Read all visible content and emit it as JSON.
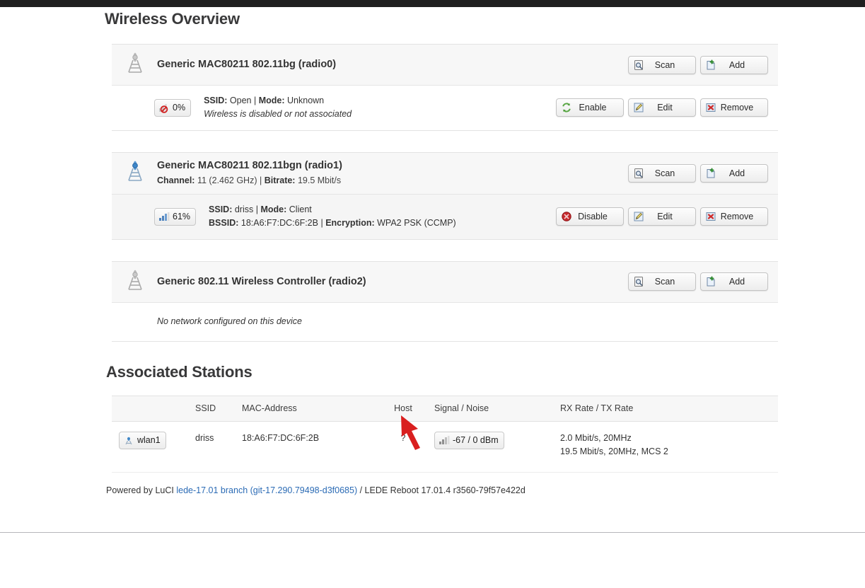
{
  "page": {
    "overview_title": "Wireless Overview",
    "stations_title": "Associated Stations"
  },
  "buttons": {
    "scan": "Scan",
    "add": "Add",
    "enable": "Enable",
    "disable": "Disable",
    "edit": "Edit",
    "remove": "Remove"
  },
  "radios": [
    {
      "icon": "antenna-disabled-icon",
      "title": "Generic MAC80211 802.11bg (radio0)",
      "subtitle": "",
      "signal": {
        "icon": "signal-none-icon",
        "text": "0%"
      },
      "line1_label_a": "SSID:",
      "line1_value_a": "Open",
      "line1_sep": "|",
      "line1_label_b": "Mode:",
      "line1_value_b": "Unknown",
      "line2_note": "Wireless is disabled or not associated",
      "toggle": "Enable"
    },
    {
      "icon": "antenna-active-icon",
      "title": "Generic MAC80211 802.11bgn (radio1)",
      "sub_label_a": "Channel:",
      "sub_value_a": "11 (2.462 GHz)",
      "sub_sep": "|",
      "sub_label_b": "Bitrate:",
      "sub_value_b": "19.5 Mbit/s",
      "signal": {
        "icon": "signal-good-icon",
        "text": "61%"
      },
      "line1_label_a": "SSID:",
      "line1_value_a": "driss",
      "line1_sep": "|",
      "line1_label_b": "Mode:",
      "line1_value_b": "Client",
      "line2_label_a": "BSSID:",
      "line2_value_a": "18:A6:F7:DC:6F:2B",
      "line2_sep": "|",
      "line2_label_b": "Encryption:",
      "line2_value_b": "WPA2 PSK (CCMP)",
      "toggle": "Disable"
    },
    {
      "icon": "antenna-disabled-icon",
      "title": "Generic 802.11 Wireless Controller (radio2)",
      "empty_note": "No network configured on this device"
    }
  ],
  "stations": {
    "headers": [
      "",
      "SSID",
      "MAC-Address",
      "Host",
      "Signal / Noise",
      "RX Rate / TX Rate"
    ],
    "rows": [
      {
        "iface": "wlan1",
        "iface_icon": "wifi-iface-icon",
        "ssid": "driss",
        "mac": "18:A6:F7:DC:6F:2B",
        "host": "?",
        "signal_icon": "signal-bars-icon",
        "signal": "-67 / 0 dBm",
        "rx_rate": "2.0 Mbit/s, 20MHz",
        "tx_rate": "19.5 Mbit/s, 20MHz, MCS 2"
      }
    ]
  },
  "footer": {
    "prefix": "Powered by LuCI",
    "link": "lede-17.01 branch (git-17.290.79498-d3f0685)",
    "suffix": "/ LEDE Reboot 17.01.4 r3560-79f57e422d"
  },
  "colors": {
    "link": "#2b6bb5",
    "annotation_arrow": "#d91f1f",
    "panel_header_bg": "#f7f7f7",
    "row_shaded_bg": "#f5f5f5"
  },
  "annotation": {
    "arrow": "red-arrow-pointing-up-left-at-host-value"
  }
}
